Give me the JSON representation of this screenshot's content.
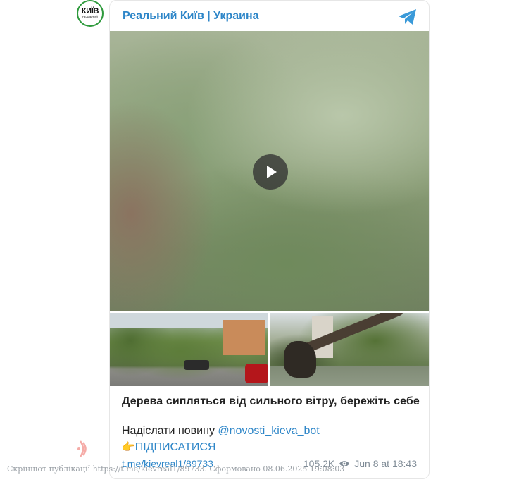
{
  "avatar": {
    "big_text": "КИЇВ",
    "small_text": "РЕАЛЬНИЙ"
  },
  "header": {
    "channel_name": "Реальний Київ | Украина",
    "icon": "telegram-icon"
  },
  "media": {
    "video_play_icon": "play-icon",
    "thumbnail_count": 2
  },
  "post": {
    "caption": "Дерева сипляться від сильного вітру, бережіть себе",
    "send_news_text": "Надіслати новину",
    "bot_link": "@novosti_kieva_bot",
    "subscribe_emoji": "👉",
    "subscribe_text": "ПІДПИСАТИСЯ",
    "post_link": "t.me/kievreal1/89733"
  },
  "meta": {
    "views": "105.2K",
    "date": "Jun 8 at 18:43",
    "views_icon": "eye-icon"
  },
  "footer": {
    "watermark": "Скріншот публікації https://t.me/kievreal1/89733. Сформовано 08.06.2025 19:08:03"
  },
  "colors": {
    "link": "#2e86c8",
    "avatar_ring": "#2e9a3c",
    "logo_mark": "#e8453c"
  }
}
